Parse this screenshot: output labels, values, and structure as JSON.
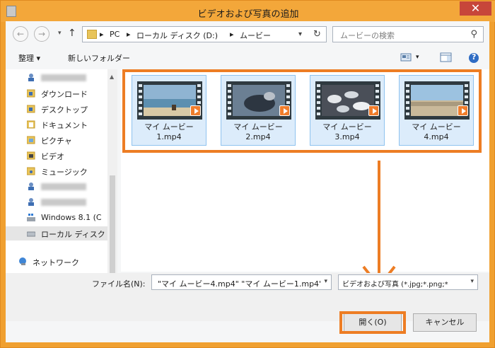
{
  "window": {
    "title": "ビデオおよび写真の追加",
    "close_glyph": "✕"
  },
  "navigation": {
    "back_glyph": "←",
    "forward_glyph": "→",
    "up_glyph": "↑",
    "breadcrumb": [
      "PC",
      "ローカル ディスク (D:)",
      "ムービー"
    ],
    "separator": "▸",
    "refresh_glyph": "↻"
  },
  "search": {
    "placeholder": "ムービーの検索",
    "icon": "search-icon"
  },
  "toolbar": {
    "organize_label": "整理 ▾",
    "new_folder_label": "新しいフォルダー",
    "help_glyph": "?"
  },
  "sidebar": {
    "items": [
      {
        "label": "",
        "icon": "homegroup-icon",
        "redacted": true
      },
      {
        "label": "ダウンロード",
        "icon": "folder-icon"
      },
      {
        "label": "デスクトップ",
        "icon": "folder-icon"
      },
      {
        "label": "ドキュメント",
        "icon": "folder-icon"
      },
      {
        "label": "ピクチャ",
        "icon": "folder-icon"
      },
      {
        "label": "ビデオ",
        "icon": "folder-icon"
      },
      {
        "label": "ミュージック",
        "icon": "folder-icon"
      },
      {
        "label": "",
        "icon": "network-drive-icon",
        "redacted": true
      },
      {
        "label": "",
        "icon": "network-drive-icon",
        "redacted": true
      },
      {
        "label": "Windows 8.1 (C",
        "icon": "windows-drive-icon"
      },
      {
        "label": "ローカル ディスク (D",
        "icon": "drive-icon",
        "selected": true
      },
      {
        "label": "ネットワーク",
        "icon": "network-icon"
      }
    ]
  },
  "files": [
    {
      "name_line1": "マイ ムービー",
      "name_line2": "1.mp4",
      "thumb": "beach"
    },
    {
      "name_line1": "マイ ムービー",
      "name_line2": "2.mp4",
      "thumb": "seals"
    },
    {
      "name_line1": "マイ ムービー",
      "name_line2": "3.mp4",
      "thumb": "birds"
    },
    {
      "name_line1": "マイ ムービー",
      "name_line2": "4.mp4",
      "thumb": "colony"
    }
  ],
  "footer": {
    "filename_label": "ファイル名(N):",
    "filename_value": "\"マイ ムービー4.mp4\" \"マイ ムービー1.mp4\"",
    "filetype_value": "ビデオおよび写真 (*.jpg;*.png;*",
    "open_label": "開く(O)",
    "cancel_label": "キャンセル",
    "dropdown_glyph": "▾"
  },
  "colors": {
    "accent_orange": "#ed7d24",
    "title_bar": "#f3a73a",
    "tile_selected": "#dcecfb"
  }
}
